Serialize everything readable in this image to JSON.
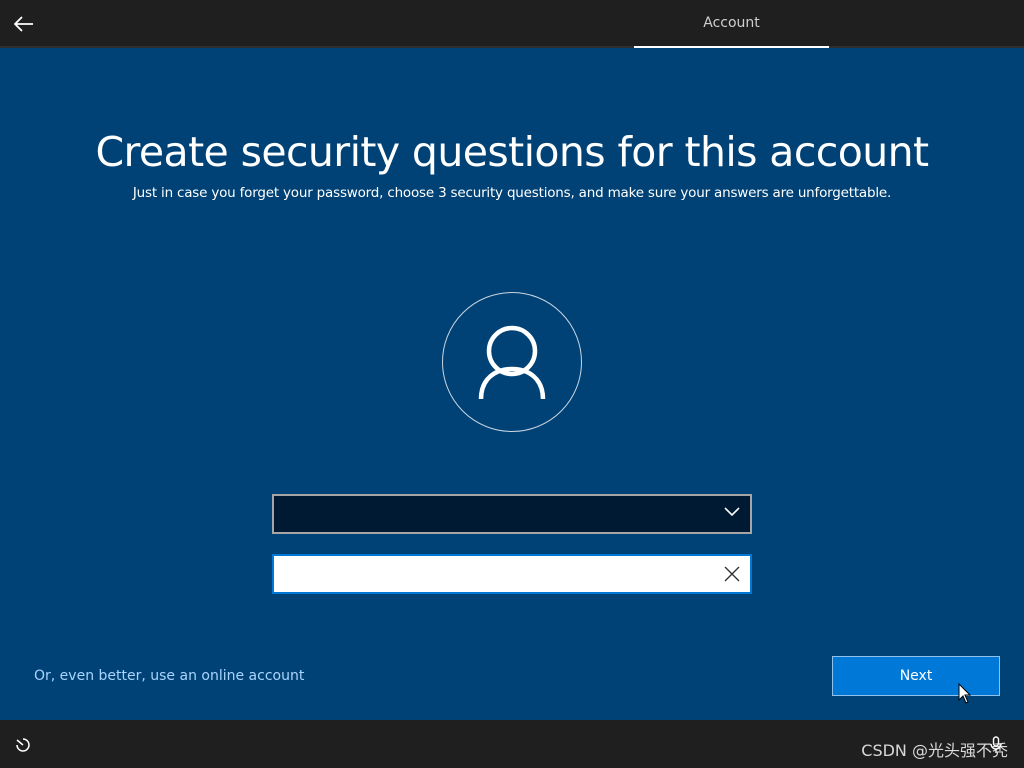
{
  "header": {
    "back_icon": "back-arrow-icon",
    "tab_label": "Account"
  },
  "main": {
    "title": "Create security questions for this account",
    "subtitle": "Just in case you forget your password, choose 3 security questions, and make sure your answers are unforgettable.",
    "avatar_icon": "user-icon",
    "security_question": {
      "selected_value": "",
      "icon": "chevron-down-icon"
    },
    "answer": {
      "value": "",
      "placeholder": "",
      "clear_icon": "close-icon"
    }
  },
  "footer": {
    "online_account_link": "Or, even better, use an online account",
    "next_label": "Next"
  },
  "bottom_bar": {
    "ease_icon": "ease-of-access-icon",
    "mic_icon": "microphone-icon",
    "watermark": "CSDN @光头强不秃"
  },
  "colors": {
    "background": "#004275",
    "bar": "#1f1f1f",
    "accent": "#0078d7",
    "link": "#a8d5ff"
  }
}
